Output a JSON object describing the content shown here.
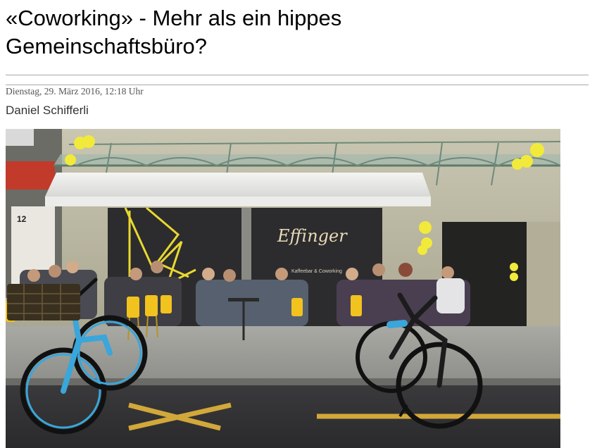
{
  "article": {
    "title_line1": "«Coworking» - Mehr als ein hippes",
    "title_line2": "Gemeinschaftsbüro?",
    "dateline": "Dienstag, 29. März 2016, 12:18 Uhr",
    "author": "Daniel Schifferli"
  },
  "photo": {
    "sign_script": "Effinger",
    "sign_sub": "Kaffeebar & Coworking",
    "house_number": "12"
  },
  "colors": {
    "rule": "#a8a8a8",
    "dateline": "#555555",
    "awning_frame": "#6f8a7a",
    "balloon": "#f2ea3a",
    "bike_blue": "#3aa6da",
    "storefront_red": "#c23a2a"
  }
}
